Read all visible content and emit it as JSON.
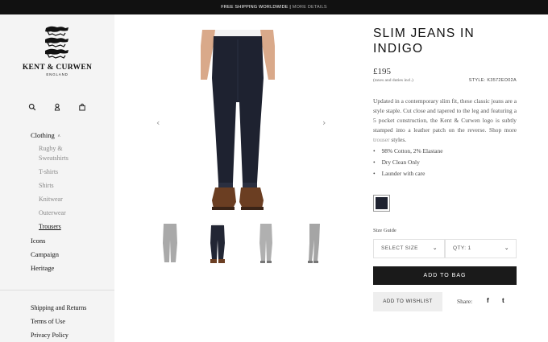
{
  "announcement": {
    "primary": "FREE SHIPPING WORLDWIDE",
    "separator": "|",
    "secondary": "MORE DETAILS"
  },
  "brand": {
    "name": "KENT & CURWEN",
    "location": "ENGLAND"
  },
  "header_icons": [
    "search-icon",
    "user-icon",
    "bag-icon"
  ],
  "nav": {
    "clothing": "Clothing",
    "clothing_caret": "^",
    "sub": [
      "Rugby &",
      "Sweatshirts",
      "T-shirts",
      "Shirts",
      "Knitwear",
      "Outerwear",
      "Trousers"
    ],
    "active_sub": "Trousers",
    "icons": "Icons",
    "campaign": "Campaign",
    "heritage": "Heritage"
  },
  "footer_links": [
    "Shipping and Returns",
    "Terms of Use",
    "Privacy Policy"
  ],
  "gallery": {
    "prev": "‹",
    "next": "›",
    "thumbnails": 4,
    "thumb_colors": [
      "#a9a9a9",
      "#222634",
      "#b0b0b0",
      "#a5a5a5"
    ]
  },
  "product": {
    "title": "SLIM JEANS IN INDIGO",
    "price": "£195",
    "tax_note": "(taxes and duties incl.)",
    "style": "STYLE: K3572EO02A",
    "description_before": "Updated in a contemporary slim fit, these classic jeans are a style staple. Cut close and tapered to the leg and featuring a 5 pocket construction, the Kent & Curwen logo is subtly stamped into a leather patch on the reverse. Shop more ",
    "description_link": "trouser",
    "description_after": " styles.",
    "bullets": [
      "98% Cotton, 2% Elastane",
      "Dry Clean Only",
      "Launder with care"
    ],
    "swatch_color": "#1e2230",
    "size_guide": "Size Guide",
    "size_select": "SELECT SIZE",
    "qty_select": "QTY: 1",
    "add_to_bag": "ADD TO BAG",
    "add_to_wishlist": "ADD TO WISHLIST",
    "share_label": "Share:",
    "facebook": "f",
    "twitter": "t"
  }
}
